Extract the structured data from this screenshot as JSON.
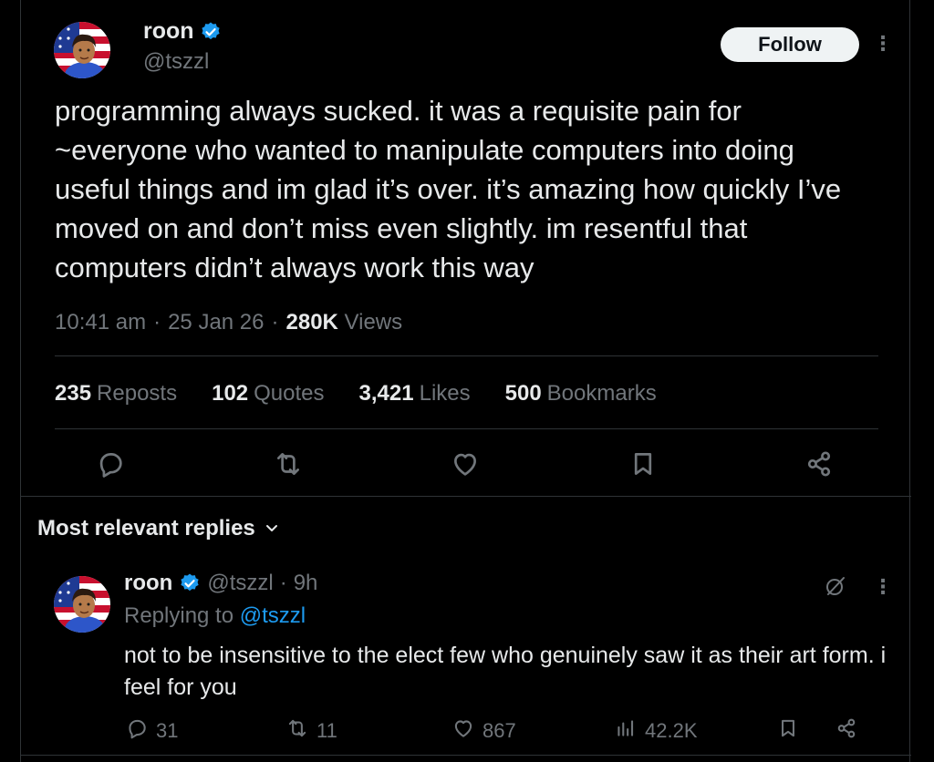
{
  "post": {
    "author_name": "roon",
    "author_handle": "@tszzl",
    "follow_label": "Follow",
    "text": "programming always sucked. it was a requisite pain for ~everyone who wanted to manipulate computers into doing useful things and im glad it’s over. it’s amazing how quickly I’ve moved on and don’t miss even slightly. im resentful that computers didn’t always work this way",
    "time": "10:41 am",
    "date": "25 Jan 26",
    "views_count": "280K",
    "views_label": "Views",
    "stats": [
      {
        "count": "235",
        "label": "Reposts"
      },
      {
        "count": "102",
        "label": "Quotes"
      },
      {
        "count": "3,421",
        "label": "Likes"
      },
      {
        "count": "500",
        "label": "Bookmarks"
      }
    ]
  },
  "replies_section": {
    "title": "Most relevant replies"
  },
  "reply": {
    "author_name": "roon",
    "author_handle": "@tszzl",
    "age": "9h",
    "replying_label": "Replying to",
    "replying_to": "@tszzl",
    "text": "not to be insensitive to the elect few who genuinely saw it as their art form. i feel for you",
    "replies": "31",
    "reposts": "11",
    "likes": "867",
    "views": "42.2K"
  },
  "colors": {
    "background": "#000000",
    "text": "#e7e9ea",
    "muted": "#71767b",
    "accent": "#1d9bf0",
    "divider": "#2f3336"
  },
  "icons": [
    "verified-badge-icon",
    "more-icon",
    "reply-icon",
    "repost-icon",
    "like-icon",
    "bookmark-icon",
    "share-icon",
    "views-icon",
    "chevron-down-icon",
    "grok-icon"
  ]
}
